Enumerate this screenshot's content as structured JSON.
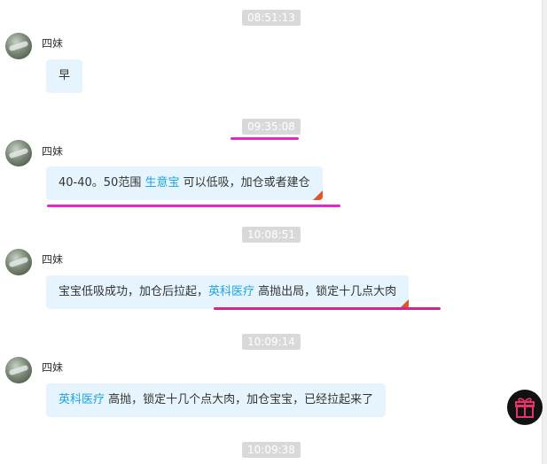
{
  "messages": [
    {
      "time": "08:51:13",
      "sender": "四妹",
      "segments": [
        {
          "text": "早",
          "kw": false
        }
      ]
    },
    {
      "time": "09:35:08",
      "sender": "四妹",
      "segments": [
        {
          "text": "40-40。50范围 ",
          "kw": false
        },
        {
          "text": "生意宝",
          "kw": true
        },
        {
          "text": " 可以低吸，加仓或者建仓",
          "kw": false
        }
      ]
    },
    {
      "time": "10:08:51",
      "sender": "四妹",
      "segments": [
        {
          "text": "宝宝低吸成功，加仓后拉起，",
          "kw": false
        },
        {
          "text": "英科医疗",
          "kw": true
        },
        {
          "text": " 高抛出局，锁定十几点大肉",
          "kw": false
        }
      ]
    },
    {
      "time": "10:09:14",
      "sender": "四妹",
      "segments": [
        {
          "text": "英科医疗",
          "kw": true
        },
        {
          "text": " 高抛，锁定十几个点大肉，加仓宝宝，已经拉起来了",
          "kw": false
        }
      ]
    },
    {
      "time": "10:09:38"
    }
  ],
  "colors": {
    "keyword": "#1ea2e0",
    "bubble": "#e6f5fd",
    "timestamp_bg": "#d9d9d9",
    "underline": "#e626c9",
    "gift_bg": "#111111"
  },
  "icons": {
    "gift": "gift-icon"
  }
}
